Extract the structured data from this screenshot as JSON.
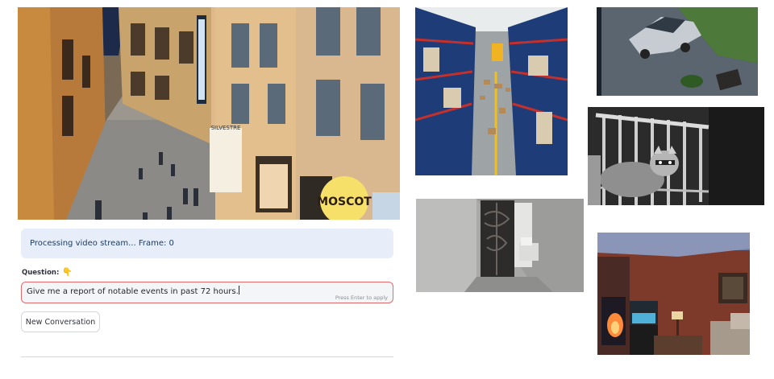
{
  "status": {
    "text": "Processing video stream... Frame: 0"
  },
  "question": {
    "label": "Question:",
    "icon": "pointing-down-hand-icon",
    "value": "Give me a report of notable events in past 72 hours.",
    "hint": "Press Enter to apply"
  },
  "buttons": {
    "new_conversation": "New Conversation"
  },
  "frames": {
    "street": {
      "sign_text": "MOSCOT",
      "store_sign": "SILVESTRE"
    }
  },
  "colors": {
    "status_bg": "#e8eef9",
    "status_text": "#1c3c63",
    "input_border": "#e36b6b",
    "input_bg": "#f4f5f7"
  }
}
